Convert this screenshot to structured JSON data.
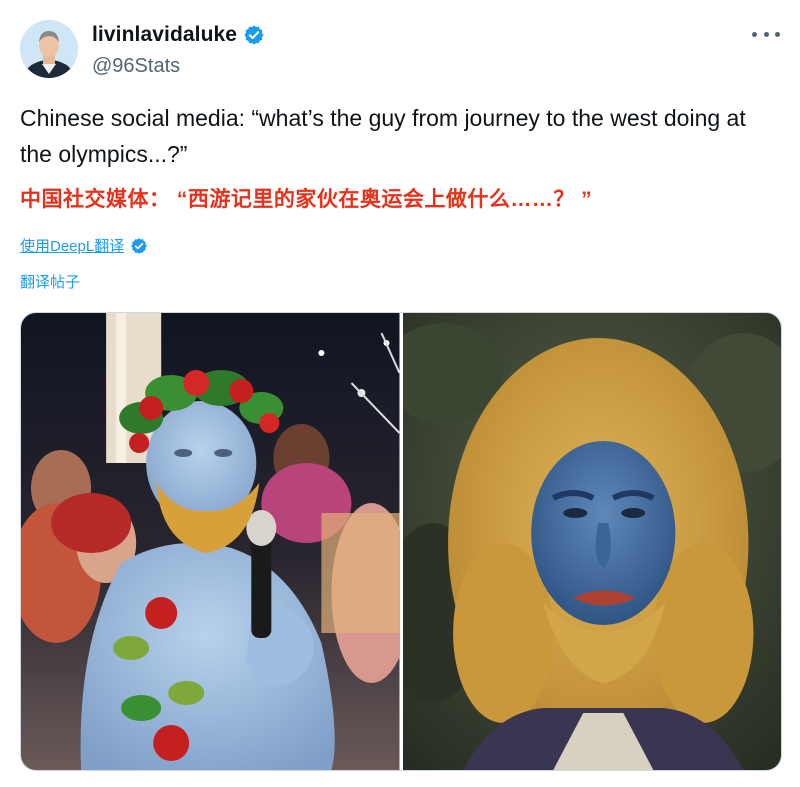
{
  "author": {
    "display_name": "livinlavidaluke",
    "handle": "@96Stats",
    "verified": true
  },
  "tweet": {
    "text": "Chinese social media: “what’s the guy from journey to the west doing at the olympics...?”",
    "translation": "中国社交媒体： “西游记里的家伙在奥运会上做什么……？ ”"
  },
  "actions": {
    "deepl_label": "使用DeepL翻译",
    "translate_post_label": "翻译帖子"
  },
  "media": {
    "photos": [
      {
        "name": "olympics-performer-photo"
      },
      {
        "name": "journey-to-the-west-character-photo"
      }
    ]
  },
  "colors": {
    "link": "#1d9bf0",
    "translation": "#e8311a",
    "verified": "#1d9bf0",
    "secondary_text": "#536471"
  },
  "icons": [
    "verified-badge-icon",
    "more-options-icon",
    "deepl-icon"
  ]
}
